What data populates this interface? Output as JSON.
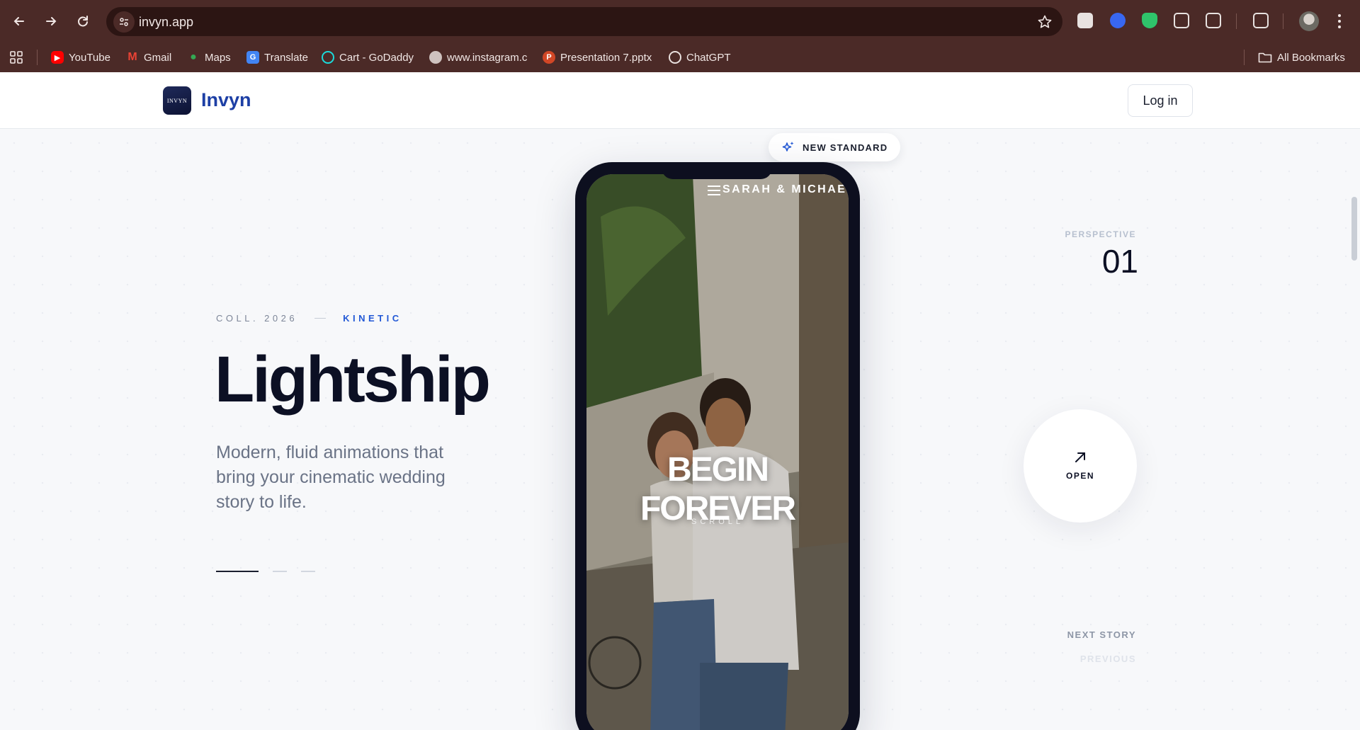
{
  "browser": {
    "url": "invyn.app",
    "bookmarks": [
      {
        "label": "YouTube",
        "icon": "youtube-icon",
        "color": "#ff0000"
      },
      {
        "label": "Gmail",
        "icon": "gmail-icon",
        "color": "#ea4335"
      },
      {
        "label": "Maps",
        "icon": "maps-icon",
        "color": "#34a853"
      },
      {
        "label": "Translate",
        "icon": "translate-icon",
        "color": "#4285f4"
      },
      {
        "label": "Cart - GoDaddy",
        "icon": "godaddy-icon",
        "color": "#1bdbdb"
      },
      {
        "label": "www.instagram.c",
        "icon": "globe-icon",
        "color": "#cfc2bf"
      },
      {
        "label": "Presentation 7.pptx",
        "icon": "powerpoint-icon",
        "color": "#d24726"
      },
      {
        "label": "ChatGPT",
        "icon": "chatgpt-icon",
        "color": "#e9e0de"
      }
    ],
    "all_bookmarks": "All Bookmarks"
  },
  "site": {
    "brand": "Invyn",
    "logo_text": "INVYN",
    "login": "Log in"
  },
  "hero": {
    "badge": "NEW STANDARD",
    "collection": "COLL. 2026",
    "tag": "KINETIC",
    "title": "Lightship",
    "description": "Modern, fluid animations that bring your cinematic wedding story to life."
  },
  "phone": {
    "names": "SARAH & MICHAEL",
    "headline": "BEGIN FOREVER",
    "scroll": "SCROLL"
  },
  "side": {
    "perspective_label": "PERSPECTIVE",
    "perspective_number": "01",
    "open": "OPEN",
    "next": "NEXT STORY",
    "previous": "PREVIOUS"
  },
  "colors": {
    "chrome": "#4b2a27",
    "brand": "#1d3fa5",
    "accent": "#2359d6",
    "ink": "#0c1024"
  }
}
